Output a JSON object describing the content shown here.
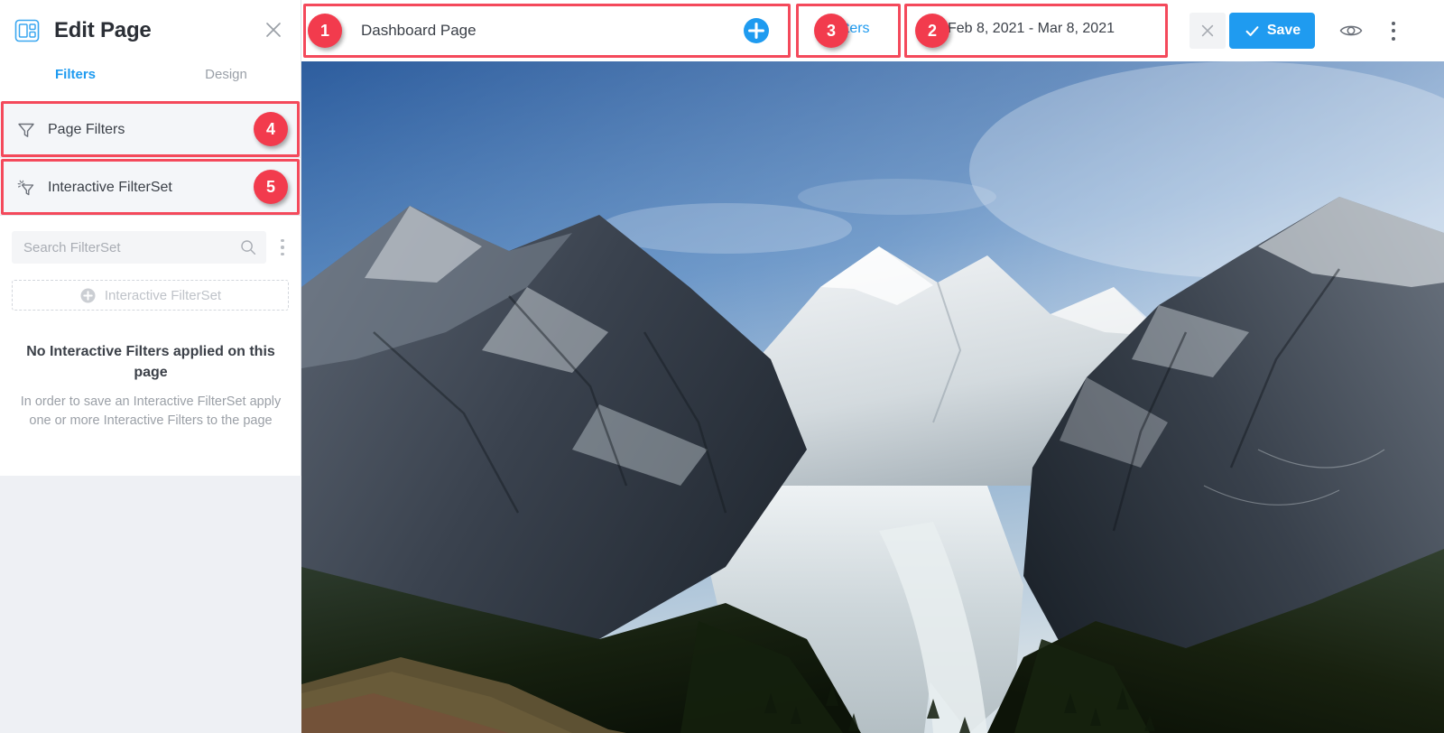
{
  "sidebar": {
    "logo_icon": "layout-page-icon",
    "title": "Edit Page",
    "close_icon": "close-icon",
    "tabs": [
      {
        "label": "Filters",
        "active": true
      },
      {
        "label": "Design",
        "active": false
      }
    ],
    "filter_rows": [
      {
        "label": "Page Filters",
        "icon": "funnel-icon"
      },
      {
        "label": "Interactive FilterSet",
        "icon": "sparkle-funnel-icon"
      }
    ],
    "search": {
      "placeholder": "Search FilterSet",
      "value": "",
      "icon": "search-icon",
      "kebab_icon": "kebab-menu-icon"
    },
    "add_filterset": {
      "label": "Interactive FilterSet",
      "icon": "plus-circle-icon"
    },
    "empty_state": {
      "title": "No Interactive Filters applied on this page",
      "description": "In order to save an Interactive FilterSet apply one or more Interactive Filters to the page"
    }
  },
  "topbar": {
    "page_name": "Dashboard Page",
    "add_icon": "plus-circle-icon",
    "filters_label": "Filters",
    "date_range": "Feb 8, 2021 - Mar 8, 2021",
    "close_icon": "close-icon",
    "save_label": "Save",
    "save_icon": "check-icon",
    "preview_icon": "eye-icon",
    "more_icon": "kebab-menu-icon"
  },
  "annotations": [
    {
      "number": "1",
      "target": "page-name-field"
    },
    {
      "number": "2",
      "target": "date-range-field"
    },
    {
      "number": "3",
      "target": "filters-link"
    },
    {
      "number": "4",
      "target": "page-filters-row"
    },
    {
      "number": "5",
      "target": "interactive-filterset-row"
    }
  ],
  "colors": {
    "accent_blue": "#1f9bf0",
    "annotation_red": "#f23b4d",
    "text_dark": "#3b4048",
    "text_muted": "#9ba0a7"
  }
}
